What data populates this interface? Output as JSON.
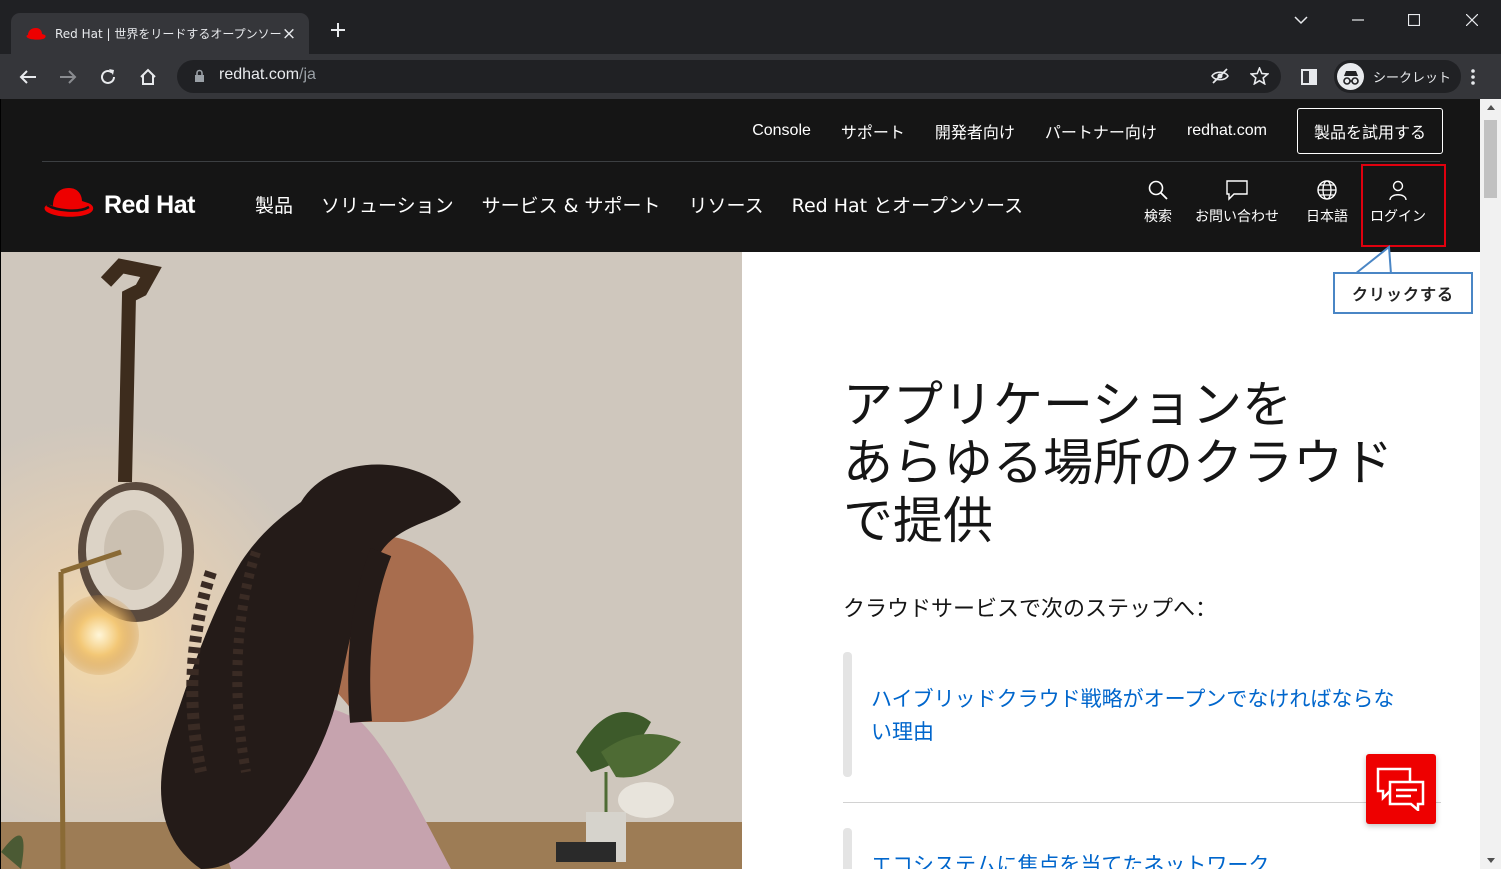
{
  "browser": {
    "tab": {
      "title": "Red Hat | 世界をリードするオープンソース企業",
      "close_icon": "×"
    },
    "new_tab_icon": "+",
    "url": {
      "host": "redhat.com",
      "path": "/ja"
    },
    "incognito_label": "シークレット"
  },
  "utility_nav": {
    "links": [
      "Console",
      "サポート",
      "開発者向け",
      "パートナー向け",
      "redhat.com"
    ],
    "try_button": "製品を試用する"
  },
  "logo": {
    "text": "Red Hat"
  },
  "main_nav": [
    "製品",
    "ソリューション",
    "サービス & サポート",
    "リソース",
    "Red Hat とオープンソース"
  ],
  "icon_nav": {
    "search": "検索",
    "contact": "お問い合わせ",
    "language": "日本語",
    "login": "ログイン"
  },
  "callout": "クリックする",
  "hero": {
    "headline": [
      "アプリケーションを",
      "あらゆる場所のクラウド",
      "で提供"
    ],
    "subhead": "クラウドサービスで次のステップへ：",
    "card1": "ハイブリッドクラウド戦略がオープンでなければならない理由",
    "card2": "エコシステムに焦点を当てたネットワーク"
  },
  "colors": {
    "brand_red": "#ee0000",
    "header_bg": "#151515",
    "link_blue": "#0066cc",
    "callout_border": "#4a86c5",
    "highlight_red": "#e0000e"
  }
}
